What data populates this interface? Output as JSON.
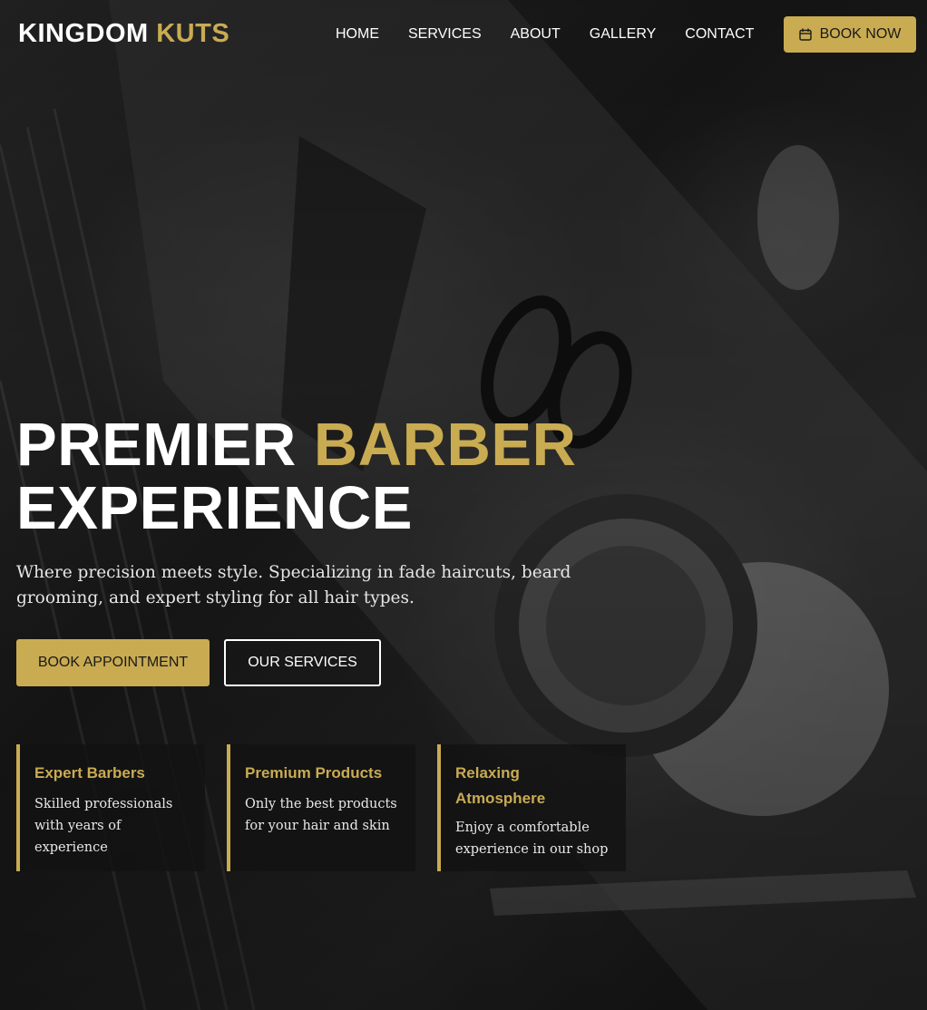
{
  "header": {
    "brand_primary": "KINGDOM",
    "brand_accent": "KUTS",
    "nav": [
      {
        "label": "HOME"
      },
      {
        "label": "SERVICES"
      },
      {
        "label": "ABOUT"
      },
      {
        "label": "GALLERY"
      },
      {
        "label": "CONTACT"
      }
    ],
    "book_now_label": "BOOK NOW",
    "book_now_icon": "calendar-icon"
  },
  "hero": {
    "title_line1_white": "PREMIER",
    "title_line1_gold": "BARBER",
    "title_line2": "EXPERIENCE",
    "subtitle": "Where precision meets style. Specializing in fade haircuts, beard grooming, and expert styling for all hair types.",
    "primary_button": "BOOK APPOINTMENT",
    "secondary_button": "OUR SERVICES"
  },
  "features": [
    {
      "title": "Expert Barbers",
      "text": "Skilled professionals with years of experience"
    },
    {
      "title": "Premium Products",
      "text": "Only the best products for your hair and skin"
    },
    {
      "title": "Relaxing Atmosphere",
      "text": "Enjoy a comfortable experience in our shop"
    }
  ],
  "colors": {
    "accent": "#c9ab52",
    "text": "#ffffff",
    "background": "#151515"
  }
}
